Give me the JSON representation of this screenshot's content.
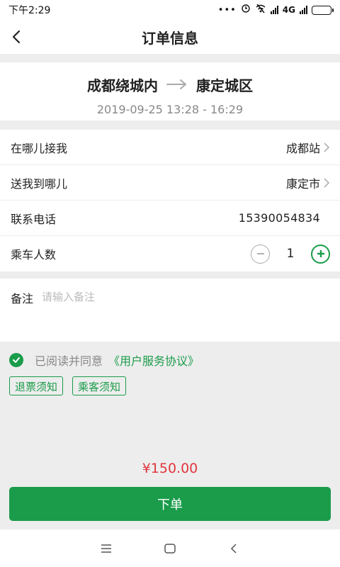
{
  "status_bar": {
    "time": "下午2:29",
    "dots": "•••",
    "network": "4G",
    "icons": [
      "signal-icon",
      "wifi-off-icon",
      "battery-icon"
    ]
  },
  "header": {
    "title": "订单信息",
    "back_icon": "chevron-left-icon"
  },
  "route": {
    "from": "成都绕城内",
    "to": "康定城区",
    "arrow_icon": "arrow-right-icon",
    "time": "2019-09-25 13:28 - 16:29"
  },
  "form": {
    "pickup_label": "在哪儿接我",
    "pickup_value": "成都站",
    "dropoff_label": "送我到哪儿",
    "dropoff_value": "康定市",
    "phone_label": "联系电话",
    "phone_value": "15390054834",
    "passengers_label": "乘车人数",
    "passengers_value": "1"
  },
  "remark": {
    "label": "备注",
    "placeholder": "请输入备注"
  },
  "agreement": {
    "text": "已阅读并同意",
    "link": "《用户服务协议》",
    "checked": true
  },
  "notices": {
    "refund": "退票须知",
    "passenger": "乘客须知"
  },
  "price": "¥150.00",
  "submit_label": "下单",
  "colors": {
    "accent": "#1a9c4a",
    "price": "#e0363e",
    "background": "#ededed"
  }
}
